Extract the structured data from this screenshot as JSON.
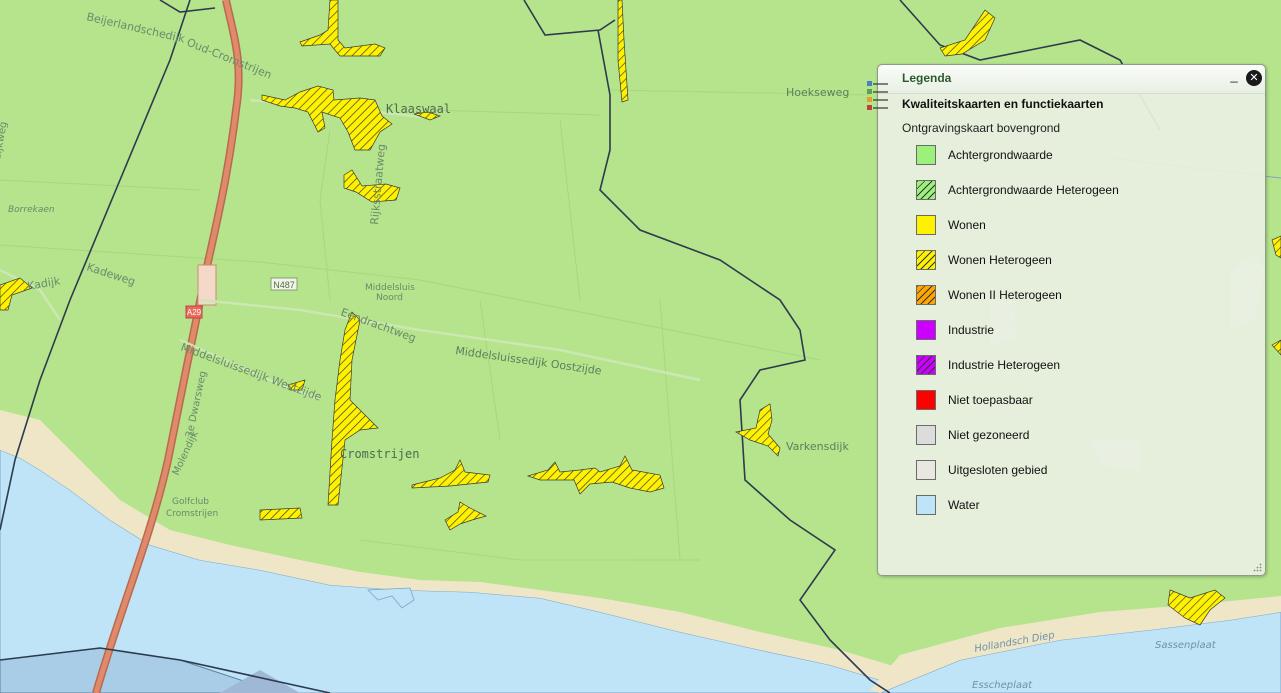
{
  "map": {
    "roads": [
      "Beijerlandsche",
      "Oud-Cromstrijen",
      "Hoekseweg",
      "Klaaswaal",
      "Rijksstraatweg",
      "Borrekaen",
      "Kadijk",
      "Kadeweg",
      "N487",
      "Middelsluis Noord",
      "Eendrachtweg",
      "Middelsluissedijk Oostzijde",
      "Middelsluissedijk Westzijde",
      "3e Dwarsweg",
      "Molendijk",
      "Cromstrijen",
      "Golfclub Cromstrijen",
      "Varkensdijk",
      "Hollandsch Diep",
      "Sassenplaat",
      "Esscheplaat",
      "A29"
    ],
    "colors": {
      "background": "#b5e48c",
      "water": "#bfe3f7",
      "beach": "#efe6c7",
      "highway": "#e1896b",
      "hatch_fill": "#fff200",
      "border": "#2e3a4e"
    }
  },
  "legend": {
    "title": "Legenda",
    "minimize_label": "_",
    "close_label": "✕",
    "group": "Kwaliteitskaarten en functiekaarten",
    "sublayer": "Ontgravingskaart bovengrond",
    "items": [
      {
        "label": "Achtergrondwaarde",
        "color": "#9cf07c",
        "hatched": false
      },
      {
        "label": "Achtergrondwaarde Heterogeen",
        "color": "#9cf07c",
        "hatched": true
      },
      {
        "label": "Wonen",
        "color": "#fff200",
        "hatched": false
      },
      {
        "label": "Wonen Heterogeen",
        "color": "#fff200",
        "hatched": true
      },
      {
        "label": "Wonen II Heterogeen",
        "color": "#ffa500",
        "hatched": true
      },
      {
        "label": "Industrie",
        "color": "#cc00ff",
        "hatched": false
      },
      {
        "label": "Industrie Heterogeen",
        "color": "#cc00ff",
        "hatched": true
      },
      {
        "label": "Niet toepasbaar",
        "color": "#ff0000",
        "hatched": false
      },
      {
        "label": "Niet gezoneerd",
        "color": "#dcdcdc",
        "hatched": false
      },
      {
        "label": "Uitgesloten gebied",
        "color": "#e8e8e0",
        "hatched": false
      },
      {
        "label": "Water",
        "color": "#bfe3f7",
        "hatched": false
      }
    ]
  }
}
